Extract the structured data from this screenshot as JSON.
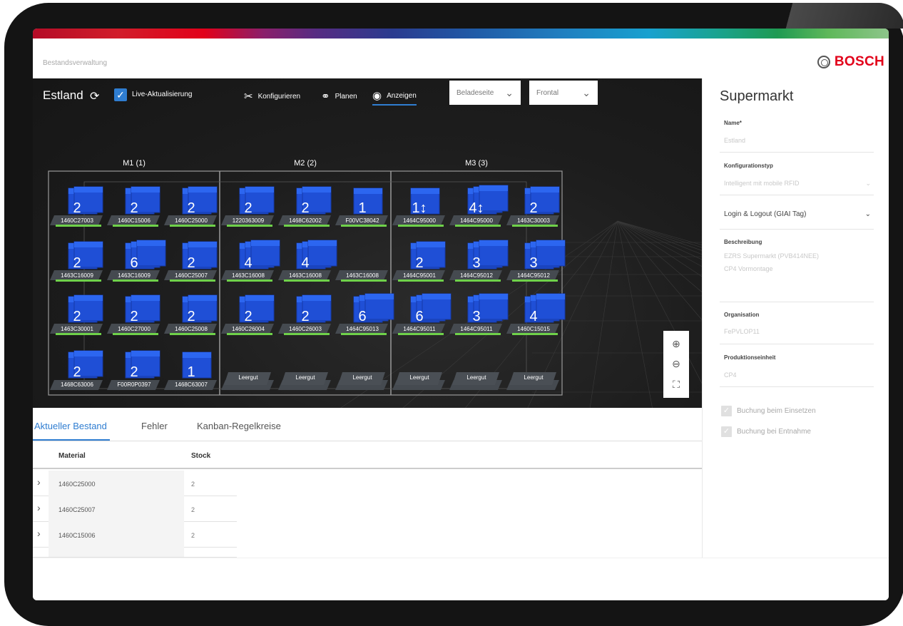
{
  "header": {
    "app_title": "Bestandsverwaltung",
    "brand": "BOSCH"
  },
  "toolbar": {
    "location": "Estland",
    "live_label": "Live-Aktualisierung",
    "tabs": [
      {
        "label": "Konfigurieren",
        "icon": "tools-icon"
      },
      {
        "label": "Planen",
        "icon": "nodes-icon"
      },
      {
        "label": "Anzeigen",
        "icon": "eye-icon"
      }
    ],
    "dropdown_side": "Beladeseite",
    "dropdown_view": "Frontal"
  },
  "rack": {
    "modules": [
      "M1 (1)",
      "M2 (2)",
      "M3 (3)"
    ],
    "rows": [
      [
        {
          "count": "2",
          "code": "1460C27003"
        },
        {
          "count": "2",
          "code": "1460C15006"
        },
        {
          "count": "2",
          "code": "1460C25000"
        },
        {
          "count": "2",
          "code": "1220363009"
        },
        {
          "count": "2",
          "code": "1468C62002"
        },
        {
          "count": "1",
          "code": "F00VC38042"
        },
        {
          "count": "1↕",
          "code": "1464C95000"
        },
        {
          "count": "4↕",
          "code": "1464C95000"
        },
        {
          "count": "2",
          "code": "1463C30003"
        }
      ],
      [
        {
          "count": "2",
          "code": "1463C16009"
        },
        {
          "count": "6",
          "code": "1463C16009"
        },
        {
          "count": "2",
          "code": "1460C25007"
        },
        {
          "count": "4",
          "code": "1463C16008"
        },
        {
          "count": "4",
          "code": "1463C16008"
        },
        {
          "count": "",
          "code": "1463C16008"
        },
        {
          "count": "2",
          "code": "1464C95001"
        },
        {
          "count": "3",
          "code": "1464C95012"
        },
        {
          "count": "3",
          "code": "1464C95012"
        }
      ],
      [
        {
          "count": "2",
          "code": "1463C30001"
        },
        {
          "count": "2",
          "code": "1460C27000"
        },
        {
          "count": "2",
          "code": "1460C25008"
        },
        {
          "count": "2",
          "code": "1460C26004"
        },
        {
          "count": "2",
          "code": "1460C26003"
        },
        {
          "count": "6",
          "code": "1464C95013"
        },
        {
          "count": "6",
          "code": "1464C95011"
        },
        {
          "count": "3",
          "code": "1464C95011"
        },
        {
          "count": "4",
          "code": "1460C15015"
        }
      ],
      [
        {
          "count": "2",
          "code": "1468C63006"
        },
        {
          "count": "2",
          "code": "F00R0P0397"
        },
        {
          "count": "1",
          "code": "1468C63007"
        },
        {
          "count": "",
          "code": "Leergut"
        },
        {
          "count": "",
          "code": "Leergut"
        },
        {
          "count": "",
          "code": "Leergut"
        },
        {
          "count": "",
          "code": "Leergut"
        },
        {
          "count": "",
          "code": "Leergut"
        },
        {
          "count": "",
          "code": "Leergut"
        }
      ]
    ]
  },
  "sidebar": {
    "title": "Supermarkt",
    "name_label": "Name*",
    "name_value": "Estland",
    "config_label": "Konfigurationstyp",
    "config_value": "Intelligent mit mobile RFID",
    "login_value": "Login & Logout (GIAI Tag)",
    "desc_label": "Beschreibung",
    "desc_line1": "EZRS Supermarkt (PVB414NEE)",
    "desc_line2": "CP4 Vormontage",
    "org_label": "Organisation",
    "org_value": "FePVLOP11",
    "unit_label": "Produktionseinheit",
    "unit_value": "CP4",
    "cb1_label": "Buchung beim Einsetzen",
    "cb2_label": "Buchung bei Entnahme"
  },
  "bottom": {
    "tabs": [
      "Aktueller Bestand",
      "Fehler",
      "Kanban-Regelkreise"
    ],
    "col_material": "Material",
    "col_stock": "Stock",
    "rows": [
      {
        "material": "1460C25000",
        "stock": "2"
      },
      {
        "material": "1460C25007",
        "stock": "2"
      },
      {
        "material": "1460C15006",
        "stock": "2"
      }
    ]
  }
}
